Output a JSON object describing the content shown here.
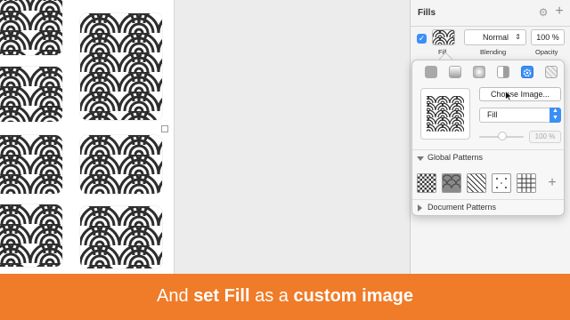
{
  "inspector": {
    "section_title": "Fills",
    "settings_icon": "gear-icon",
    "add_icon": "plus-icon",
    "fill": {
      "enabled": true,
      "blending_value": "Normal",
      "opacity_value": "100 %",
      "fill_label": "Fill",
      "blending_label": "Blending",
      "opacity_label": "Opacity"
    }
  },
  "popover": {
    "fill_types": [
      "solid-color",
      "linear-gradient",
      "radial-gradient",
      "angular-gradient",
      "pattern-fill",
      "noise-fill"
    ],
    "selected_fill_type": "pattern-fill",
    "choose_image_label": "Choose Image...",
    "pattern_mode_value": "Fill",
    "tile_scale_value": "100 %",
    "global_patterns_label": "Global Patterns",
    "document_patterns_label": "Document Patterns",
    "global_patterns": [
      "checker-pattern",
      "scales-pattern",
      "diagonal-stripes-pattern",
      "dots-pattern",
      "grid-pattern"
    ],
    "add_pattern_icon": "plus-icon"
  },
  "caption": {
    "part1": "And ",
    "part2": "set Fill",
    "part3": " as a ",
    "part4": "custom image"
  },
  "colors": {
    "accent": "#3b8ff6",
    "banner": "#f07b28",
    "pattern_dark": "#2d2d2d"
  }
}
